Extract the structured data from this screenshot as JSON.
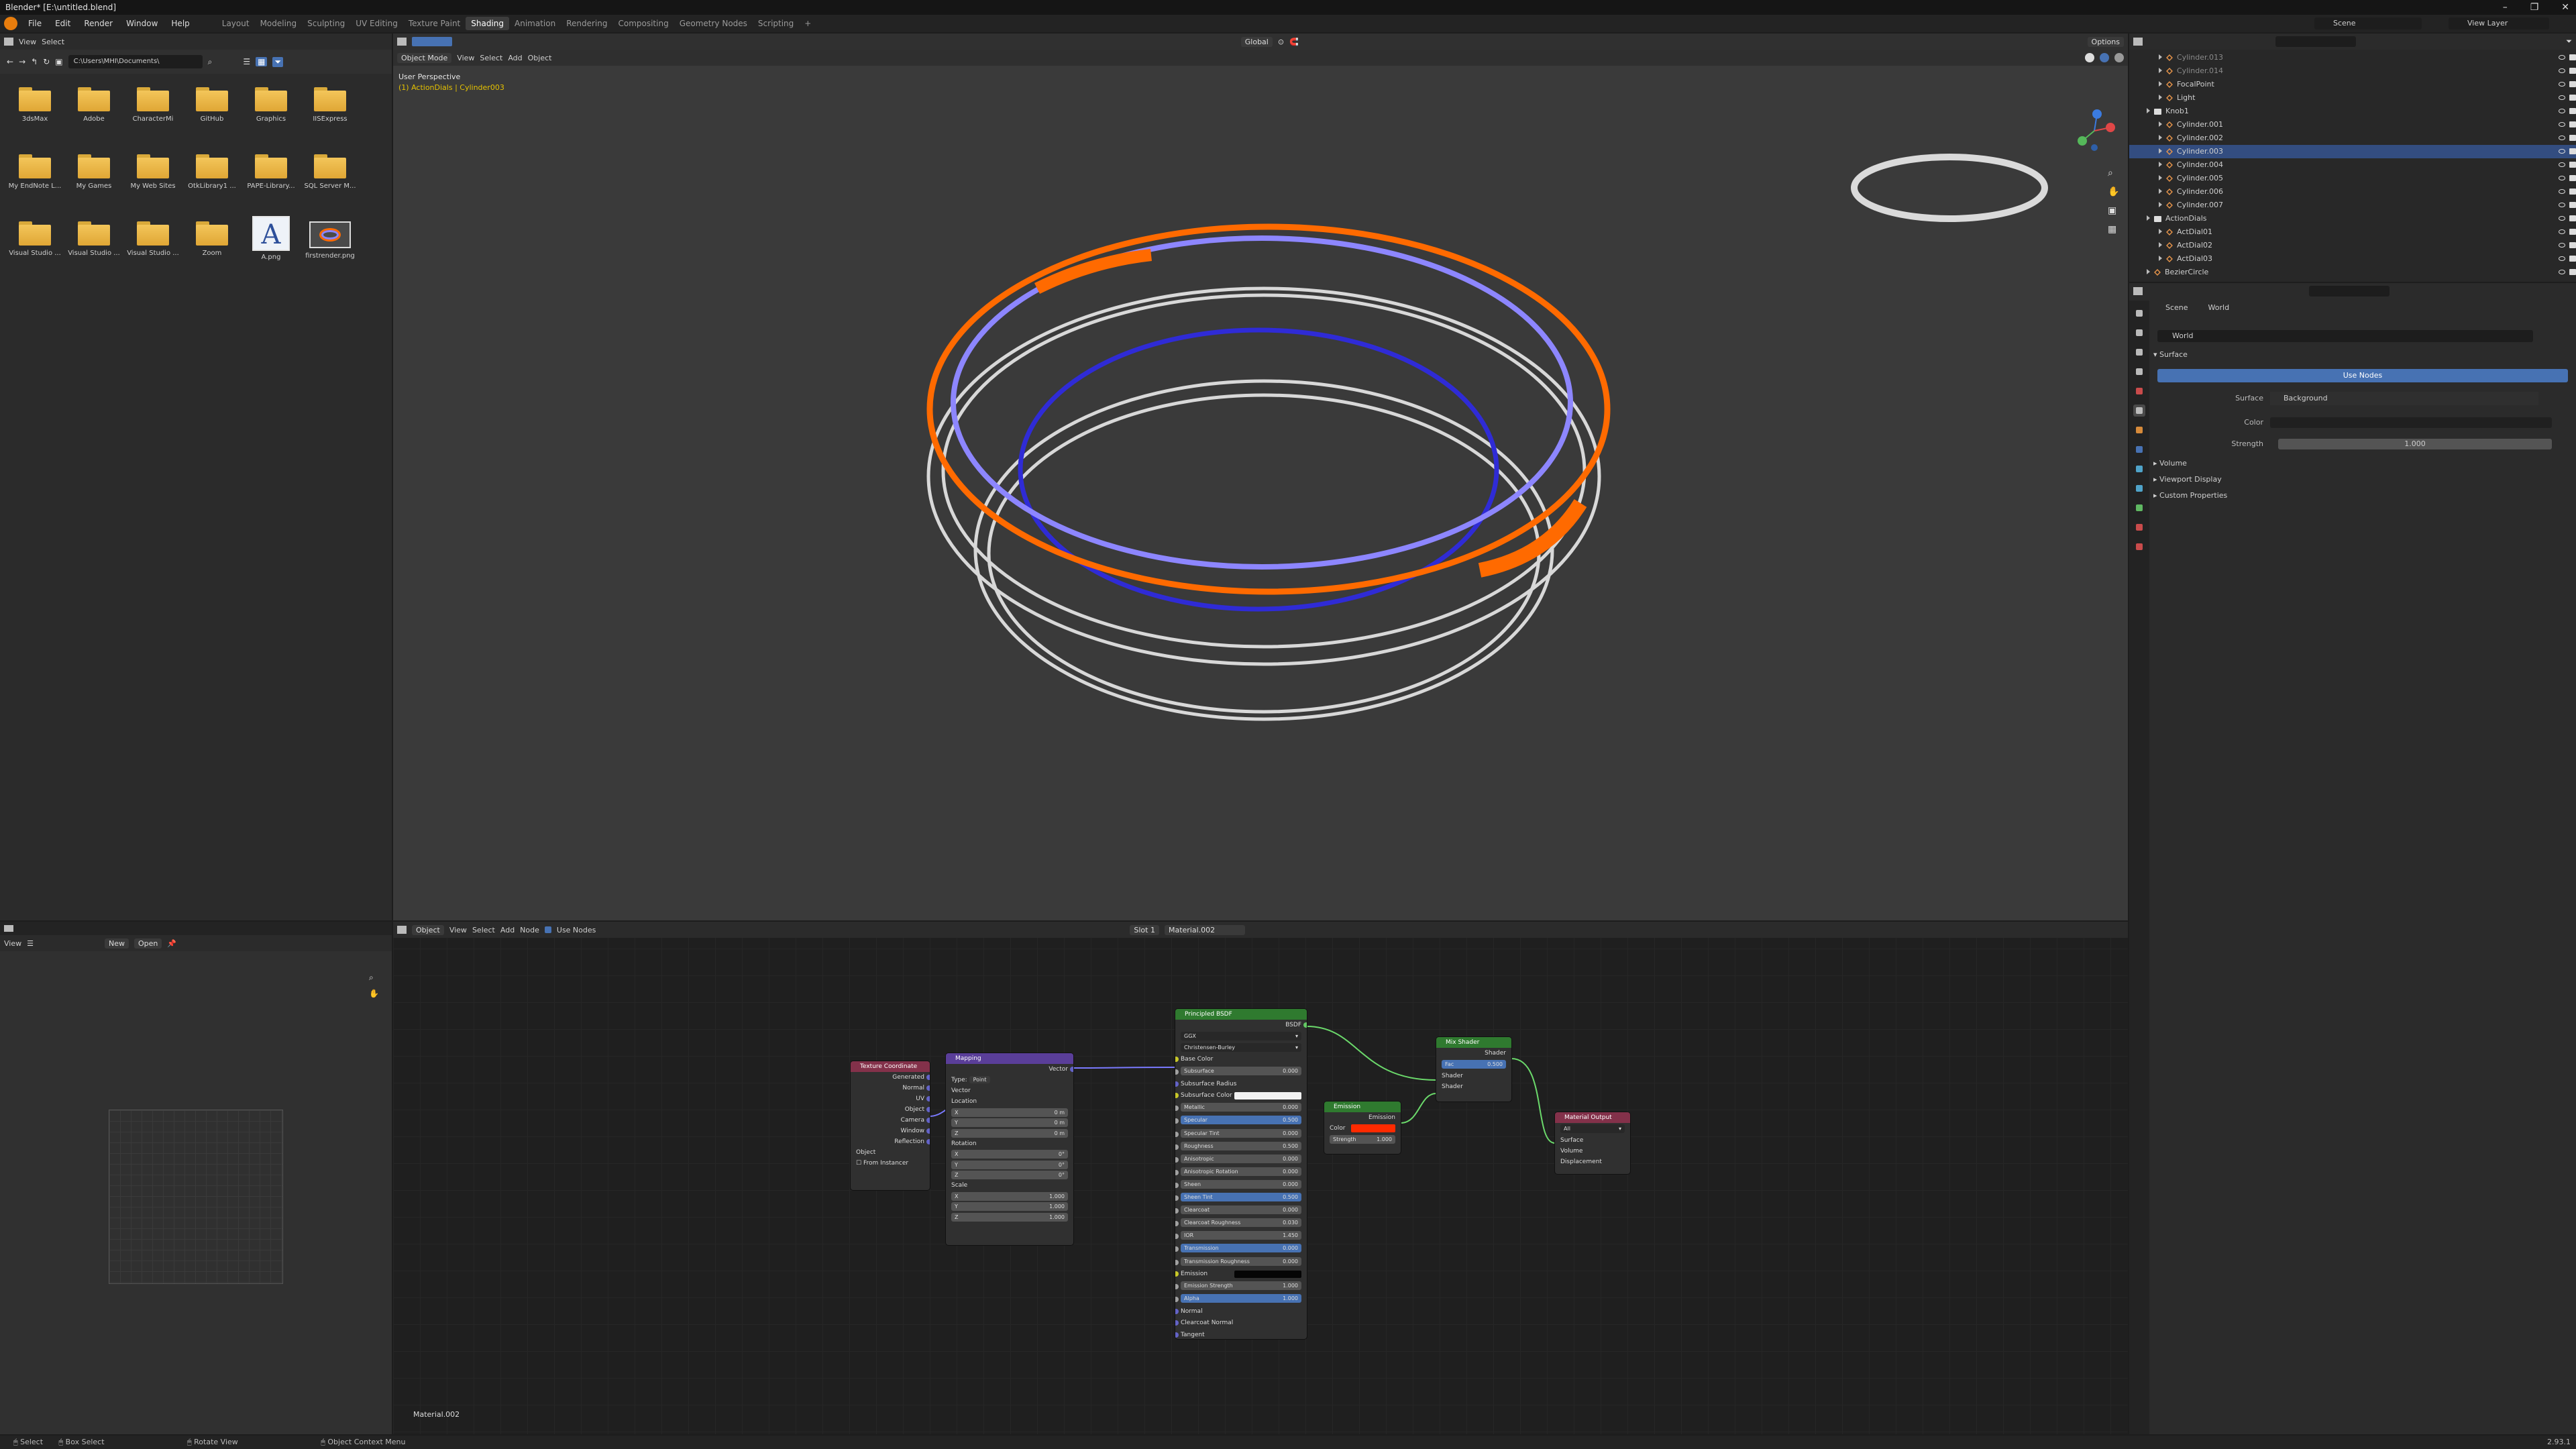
{
  "window": {
    "title": "Blender* [E:\\untitled.blend]",
    "controls": [
      "–",
      "❐",
      "✕"
    ]
  },
  "menu": [
    "File",
    "Edit",
    "Render",
    "Window",
    "Help"
  ],
  "workspaces": [
    "Layout",
    "Modeling",
    "Sculpting",
    "UV Editing",
    "Texture Paint",
    "Shading",
    "Animation",
    "Rendering",
    "Compositing",
    "Geometry Nodes",
    "Scripting",
    "+"
  ],
  "active_workspace": "Shading",
  "scene": {
    "scene_name": "Scene",
    "view_layer": "View Layer"
  },
  "file_browser": {
    "menu": [
      "View",
      "Select"
    ],
    "path": "C:\\Users\\MHI\\Documents\\",
    "items": [
      {
        "label": "3dsMax",
        "kind": "folder"
      },
      {
        "label": "Adobe",
        "kind": "folder"
      },
      {
        "label": "CharacterMi",
        "kind": "folder"
      },
      {
        "label": "GitHub",
        "kind": "folder"
      },
      {
        "label": "Graphics",
        "kind": "folder"
      },
      {
        "label": "IISExpress",
        "kind": "folder"
      },
      {
        "label": "My EndNote L...",
        "kind": "folder"
      },
      {
        "label": "My Games",
        "kind": "folder"
      },
      {
        "label": "My Web Sites",
        "kind": "folder"
      },
      {
        "label": "OtkLibrary1 ...",
        "kind": "folder"
      },
      {
        "label": "PAPE-Library...",
        "kind": "folder"
      },
      {
        "label": "SQL Server M...",
        "kind": "folder"
      },
      {
        "label": "Visual Studio ...",
        "kind": "folder"
      },
      {
        "label": "Visual Studio ...",
        "kind": "folder"
      },
      {
        "label": "Visual Studio ...",
        "kind": "folder"
      },
      {
        "label": "Zoom",
        "kind": "folder"
      },
      {
        "label": "A.png",
        "kind": "image-a"
      },
      {
        "label": "firstrender.png",
        "kind": "image-render"
      }
    ]
  },
  "viewport": {
    "mode": "Object Mode",
    "menu": [
      "View",
      "Select",
      "Add",
      "Object"
    ],
    "transform": "Global",
    "options": "Options",
    "overlay_title": "User Perspective",
    "overlay_subtitle": "(1) ActionDials | Cylinder003"
  },
  "outliner": {
    "rows": [
      {
        "label": "Cylinder.013",
        "type": "obj",
        "indent": 2,
        "dim": true
      },
      {
        "label": "Cylinder.014",
        "type": "obj",
        "indent": 2,
        "dim": true
      },
      {
        "label": "FocalPoint",
        "type": "empty",
        "indent": 2
      },
      {
        "label": "Light",
        "type": "light",
        "indent": 2
      },
      {
        "label": "Knob1",
        "type": "col",
        "indent": 1
      },
      {
        "label": "Cylinder.001",
        "type": "obj",
        "indent": 2
      },
      {
        "label": "Cylinder.002",
        "type": "obj",
        "indent": 2
      },
      {
        "label": "Cylinder.003",
        "type": "obj",
        "indent": 2,
        "selected": true
      },
      {
        "label": "Cylinder.004",
        "type": "obj",
        "indent": 2
      },
      {
        "label": "Cylinder.005",
        "type": "obj",
        "indent": 2
      },
      {
        "label": "Cylinder.006",
        "type": "obj",
        "indent": 2
      },
      {
        "label": "Cylinder.007",
        "type": "obj",
        "indent": 2
      },
      {
        "label": "ActionDials",
        "type": "col",
        "indent": 1
      },
      {
        "label": "ActDial01",
        "type": "obj",
        "indent": 2
      },
      {
        "label": "ActDial02",
        "type": "obj",
        "indent": 2
      },
      {
        "label": "ActDial03",
        "type": "obj",
        "indent": 2
      },
      {
        "label": "BezierCircle",
        "type": "curve",
        "indent": 1
      }
    ]
  },
  "properties": {
    "breadcrumb": [
      "Scene",
      "World"
    ],
    "world_name": "World",
    "section_surface": "Surface",
    "use_nodes": "Use Nodes",
    "surface_label": "Surface",
    "surface_value": "Background",
    "color_label": "Color",
    "strength_label": "Strength",
    "strength_value": "1.000",
    "collapsed": [
      "Volume",
      "Viewport Display",
      "Custom Properties"
    ]
  },
  "image_editor": {
    "view": "View",
    "new": "New",
    "open": "Open"
  },
  "node_editor": {
    "object": "Object",
    "menu": [
      "View",
      "Select",
      "Add",
      "Node"
    ],
    "use_nodes": "Use Nodes",
    "slot": "Slot 1",
    "material": "Material.002",
    "footer": "Material.002",
    "nodes": {
      "texcoord": {
        "title": "Texture Coordinate",
        "outputs": [
          "Generated",
          "Normal",
          "UV",
          "Object",
          "Camera",
          "Window",
          "Reflection"
        ],
        "object_label": "Object",
        "from_instancer": "From Instancer"
      },
      "mapping": {
        "title": "Mapping",
        "out": "Vector",
        "type_label": "Type:",
        "type_value": "Point",
        "vector_label": "Vector",
        "location_label": "Location",
        "rotation_label": "Rotation",
        "scale_label": "Scale",
        "location": [
          [
            "X",
            "0 m"
          ],
          [
            "Y",
            "0 m"
          ],
          [
            "Z",
            "0 m"
          ]
        ],
        "rotation": [
          [
            "X",
            "0°"
          ],
          [
            "Y",
            "0°"
          ],
          [
            "Z",
            "0°"
          ]
        ],
        "scale": [
          [
            "X",
            "1.000"
          ],
          [
            "Y",
            "1.000"
          ],
          [
            "Z",
            "1.000"
          ]
        ]
      },
      "principled": {
        "title": "Principled BSDF",
        "out": "BSDF",
        "dist": "GGX",
        "sss_method": "Christensen-Burley",
        "rows": [
          [
            "Base Color",
            ""
          ],
          [
            "Subsurface",
            "0.000"
          ],
          [
            "Subsurface Radius",
            ""
          ],
          [
            "Subsurface Color",
            ""
          ],
          [
            "Metallic",
            "0.000"
          ],
          [
            "Specular",
            "0.500"
          ],
          [
            "Specular Tint",
            "0.000"
          ],
          [
            "Roughness",
            "0.500"
          ],
          [
            "Anisotropic",
            "0.000"
          ],
          [
            "Anisotropic Rotation",
            "0.000"
          ],
          [
            "Sheen",
            "0.000"
          ],
          [
            "Sheen Tint",
            "0.500"
          ],
          [
            "Clearcoat",
            "0.000"
          ],
          [
            "Clearcoat Roughness",
            "0.030"
          ],
          [
            "IOR",
            "1.450"
          ],
          [
            "Transmission",
            "0.000"
          ],
          [
            "Transmission Roughness",
            "0.000"
          ],
          [
            "Emission",
            ""
          ],
          [
            "Emission Strength",
            "1.000"
          ],
          [
            "Alpha",
            "1.000"
          ],
          [
            "Normal",
            ""
          ],
          [
            "Clearcoat Normal",
            ""
          ],
          [
            "Tangent",
            ""
          ]
        ]
      },
      "emission": {
        "title": "Emission",
        "out": "Emission",
        "color_label": "Color",
        "strength_label": "Strength",
        "strength_value": "1.000"
      },
      "mix": {
        "title": "Mix Shader",
        "out": "Shader",
        "fac_label": "Fac",
        "fac_value": "0.500",
        "in1": "Shader",
        "in2": "Shader"
      },
      "output": {
        "title": "Material Output",
        "target": "All",
        "inputs": [
          "Surface",
          "Volume",
          "Displacement"
        ]
      }
    }
  },
  "statusbar": {
    "select": "Select",
    "box_select": "Box Select",
    "rotate": "Rotate View",
    "context": "Object Context Menu",
    "version": "2.93.1"
  },
  "colors": {
    "orange": "#ff6a00",
    "violet": "#8d86ff",
    "blue": "#2f2bd6",
    "silver": "#d8d8d8",
    "selection": "#334d80",
    "accent": "#4772b3",
    "emission_color": "#ff2a00"
  }
}
